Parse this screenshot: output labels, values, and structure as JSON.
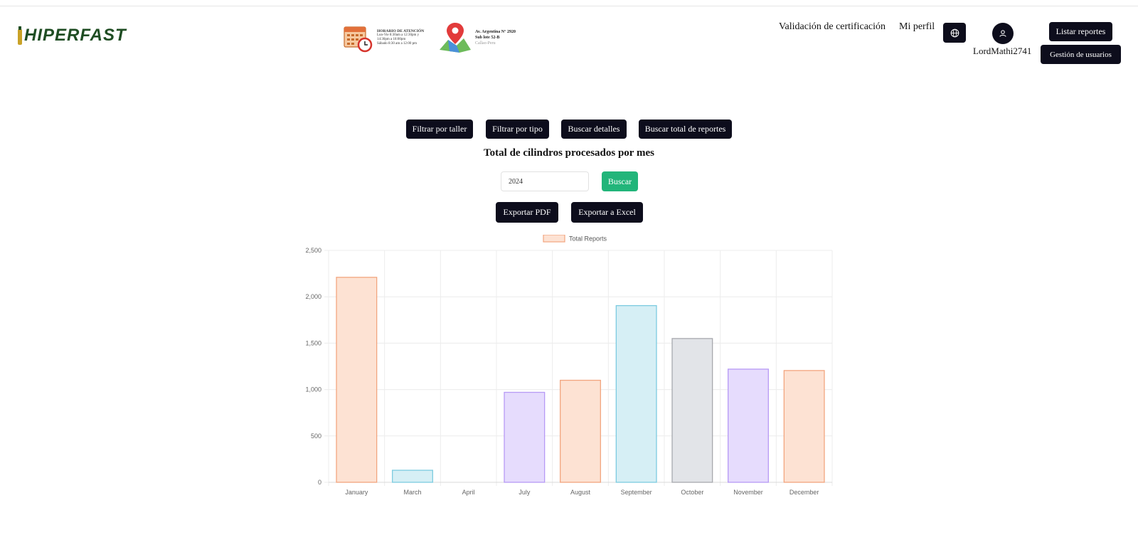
{
  "header": {
    "logo_text": "HIPERFAST",
    "banner": {
      "schedule_title": "HORARIO DE ATENCIÓN",
      "schedule_line1": "Lun-Vie 8:30am a 12:30pm y",
      "schedule_line2": "14:30pm a 18:00pm",
      "schedule_line3": "Sábado 8:30 am a 12:00 pm",
      "address_line1": "Av. Argentina N° 2920",
      "address_line2": "Sub lote 52-B",
      "address_city": "Callao-Peru"
    },
    "nav": {
      "validacion": "Validación de certificación",
      "perfil": "Mi perfil",
      "listar": "Listar reportes",
      "gestion": "Gestión de usuarios"
    },
    "username": "LordMathi2741"
  },
  "filters": {
    "taller": "Filtrar por taller",
    "tipo": "Filtrar por tipo",
    "detalles": "Buscar detalles",
    "total": "Buscar total de reportes"
  },
  "main": {
    "title": "Total de cilindros procesados por mes",
    "year_value": "2024",
    "search_label": "Buscar",
    "export_pdf": "Exportar PDF",
    "export_excel": "Exportar a Excel"
  },
  "chart_data": {
    "type": "bar",
    "categories": [
      "January",
      "March",
      "April",
      "July",
      "August",
      "September",
      "October",
      "November",
      "December"
    ],
    "series": [
      {
        "name": "Total Reports",
        "values": [
          2210,
          130,
          0,
          970,
          1100,
          1905,
          1550,
          1220,
          1205
        ]
      }
    ],
    "ylim": [
      0,
      2500
    ],
    "yticks": [
      "0",
      "500",
      "1,000",
      "1,500",
      "2,000",
      "2,500"
    ],
    "grid": true,
    "legend": "top",
    "colors": [
      {
        "fill": "#fde2d3",
        "stroke": "#f2a57f"
      },
      {
        "fill": "#d6eff5",
        "stroke": "#7ccbe0"
      },
      {
        "fill": "#ffeec9",
        "stroke": "#ffcd62"
      },
      {
        "fill": "#e6dcfd",
        "stroke": "#b79af5"
      },
      {
        "fill": "#fde2d3",
        "stroke": "#f2a57f"
      },
      {
        "fill": "#d6eff5",
        "stroke": "#7ccbe0"
      },
      {
        "fill": "#e2e4e8",
        "stroke": "#a7a9ae"
      },
      {
        "fill": "#e6dcfd",
        "stroke": "#b79af5"
      },
      {
        "fill": "#fde2d3",
        "stroke": "#f2a57f"
      }
    ],
    "legend_color": {
      "fill": "#fde2d3",
      "stroke": "#f2a57f"
    }
  },
  "icons": {
    "globe": "globe-icon",
    "user": "user-icon"
  }
}
